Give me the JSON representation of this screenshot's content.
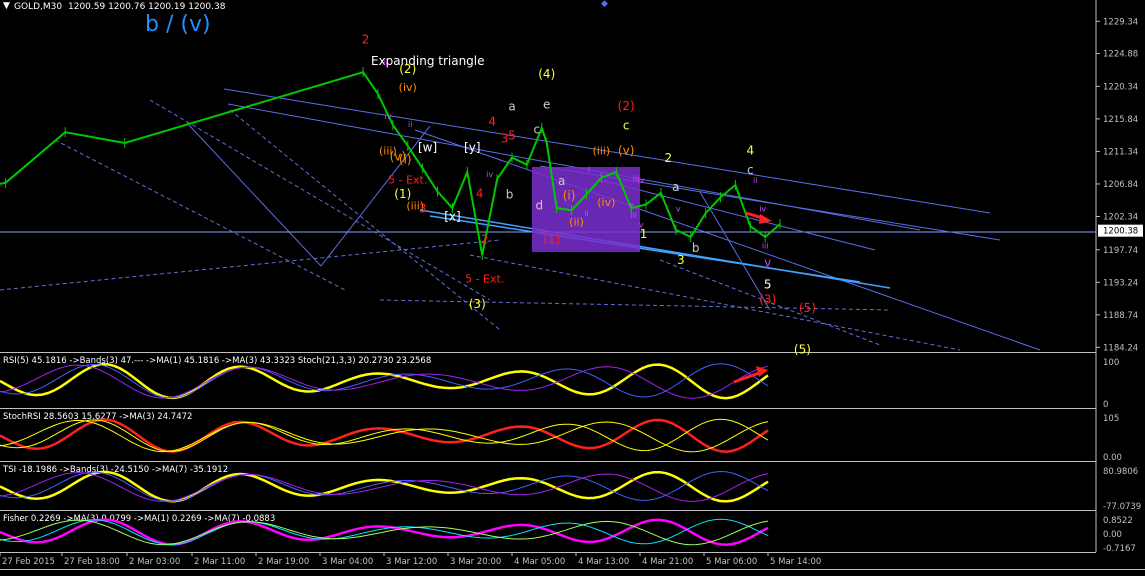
{
  "header": {
    "symbol_label": "GOLD,M30",
    "ohlc_label": "1200.59 1200.76 1200.19 1200.38"
  },
  "colors": {
    "background": "#000000",
    "axis": "#c0c0c0",
    "bull_candle": "#00c800",
    "bear_candle": "#00c800",
    "trendline": "#5a6ee8",
    "wave_red": "#ff2020",
    "wave_yellow": "#ffff40",
    "wave_orange": "#ff8c00",
    "wave_magenta": "#d040ff",
    "wave_white": "#ffffff",
    "wave_gray": "#c8c8c8",
    "highlight_box": "#7b2fd0",
    "title_blue": "#1e90ff"
  },
  "annotations": {
    "main_wave": "b / (v)",
    "pattern": "Expanding triangle",
    "labels": [
      {
        "t": "2",
        "c": "wave_red",
        "x": "2 Mar 00:30",
        "y": 1226.3
      },
      {
        "t": "(2)",
        "c": "wave_yellow",
        "x": "2 Mar 09:00",
        "y": 1222.2
      },
      {
        "t": "(4)",
        "c": "wave_yellow",
        "x": "3 Mar 13:00",
        "y": 1221.5
      },
      {
        "t": "e",
        "c": "wave_gray",
        "x": "3 Mar 13:00",
        "y": 1217.3
      },
      {
        "t": "a",
        "c": "wave_gray",
        "x": "3 Mar 06:00",
        "y": 1217.0
      },
      {
        "t": "c",
        "c": "wave_gray",
        "x": "3 Mar 11:00",
        "y": 1213.8
      },
      {
        "t": "4",
        "c": "wave_red",
        "x": "3 Mar 02:00",
        "y": 1214.9
      },
      {
        "t": "3",
        "c": "wave_red",
        "x": "3 Mar 04:30",
        "y": 1212.6
      },
      {
        "t": "5",
        "c": "wave_red",
        "x": "3 Mar 06:00",
        "y": 1213.0
      },
      {
        "t": "[w]",
        "c": "wave_white",
        "x": "2 Mar 13:00",
        "y": 1211.3
      },
      {
        "t": "[y]",
        "c": "wave_white",
        "x": "2 Mar 22:00",
        "y": 1211.3
      },
      {
        "t": "[x]",
        "c": "wave_white",
        "x": "2 Mar 18:00",
        "y": 1201.8
      },
      {
        "t": "5 - Ext.",
        "c": "wave_red",
        "x": "2 Mar 09:00",
        "y": 1206.9
      },
      {
        "t": "(1)",
        "c": "wave_yellow",
        "x": "2 Mar 08:00",
        "y": 1204.9
      },
      {
        "t": "(iii)",
        "c": "wave_orange",
        "x": "2 Mar 10:30",
        "y": 1203.3
      },
      {
        "t": "(iii)",
        "c": "wave_orange",
        "x": "2 Mar 05:00",
        "y": 1210.9
      },
      {
        "t": "(iv)",
        "c": "wave_orange",
        "x": "2 Mar 09:00",
        "y": 1219.7
      },
      {
        "t": "(v)",
        "c": "wave_orange",
        "x": "2 Mar 07:00",
        "y": 1210.1
      },
      {
        "t": "(i)",
        "c": "wave_orange",
        "x": "2 Mar 08:30",
        "y": 1209.7
      },
      {
        "t": "3",
        "c": "wave_red",
        "x": "2 Mar 12:00",
        "y": 1202.9
      },
      {
        "t": "4",
        "c": "wave_red",
        "x": "2 Mar 23:30",
        "y": 1205.0
      },
      {
        "t": "2",
        "c": "wave_red",
        "x": "3 Mar 00:30",
        "y": 1198.6
      },
      {
        "t": "b",
        "c": "wave_gray",
        "x": "3 Mar 05:30",
        "y": 1204.8
      },
      {
        "t": "5 - Ext.",
        "c": "wave_red",
        "x": "3 Mar 00:30",
        "y": 1193.2
      },
      {
        "t": "(3)",
        "c": "wave_yellow",
        "x": "2 Mar 23:00",
        "y": 1189.7
      },
      {
        "t": "d",
        "c": "wave_gray",
        "x": "3 Mar 11:30",
        "y": 1203.3
      },
      {
        "t": "a",
        "c": "wave_gray",
        "x": "3 Mar 16:00",
        "y": 1206.7
      },
      {
        "t": "(1)",
        "c": "wave_red",
        "x": "3 Mar 14:00",
        "y": 1198.6
      },
      {
        "t": "(i)",
        "c": "wave_orange",
        "x": "3 Mar 17:30",
        "y": 1204.7
      },
      {
        "t": "(ii)",
        "c": "wave_orange",
        "x": "3 Mar 19:00",
        "y": 1201.1
      },
      {
        "t": "(iii)",
        "c": "wave_orange",
        "x": "4 Mar 00:00",
        "y": 1210.9
      },
      {
        "t": "(iv)",
        "c": "wave_orange",
        "x": "4 Mar 01:00",
        "y": 1203.8
      },
      {
        "t": "(v)",
        "c": "wave_orange",
        "x": "4 Mar 05:00",
        "y": 1210.9
      },
      {
        "t": "c",
        "c": "wave_yellow",
        "x": "4 Mar 05:00",
        "y": 1214.4
      },
      {
        "t": "(2)",
        "c": "wave_red",
        "x": "4 Mar 05:00",
        "y": 1217.1
      },
      {
        "t": "1",
        "c": "wave_yellow",
        "x": "4 Mar 08:30",
        "y": 1199.4
      },
      {
        "t": "2",
        "c": "wave_yellow",
        "x": "4 Mar 13:30",
        "y": 1209.9
      },
      {
        "t": "a",
        "c": "wave_gray",
        "x": "4 Mar 15:00",
        "y": 1205.9
      },
      {
        "t": "3",
        "c": "wave_yellow",
        "x": "4 Mar 16:00",
        "y": 1195.8
      },
      {
        "t": "b",
        "c": "wave_gray",
        "x": "4 Mar 19:00",
        "y": 1197.4
      },
      {
        "t": "4",
        "c": "wave_yellow",
        "x": "5 Mar 06:00",
        "y": 1210.9
      },
      {
        "t": "c",
        "c": "wave_gray",
        "x": "5 Mar 06:00",
        "y": 1208.2
      },
      {
        "t": "v",
        "c": "wave_magenta",
        "x": "5 Mar 09:30",
        "y": 1195.4
      },
      {
        "t": "5",
        "c": "wave_white",
        "x": "5 Mar 09:30",
        "y": 1192.4
      },
      {
        "t": "(3)",
        "c": "wave_red",
        "x": "5 Mar 09:30",
        "y": 1190.3
      },
      {
        "t": "(5)",
        "c": "wave_red",
        "x": "5 Mar 17:30",
        "y": 1189.1
      },
      {
        "t": "(5)",
        "c": "wave_yellow",
        "x": "5 Mar 16:30",
        "y": 1183.4
      }
    ],
    "micro_labels": [
      {
        "t": "i",
        "x": "3 Mar 21:30",
        "y": 1208.5
      },
      {
        "t": "ii",
        "x": "3 Mar 21:00",
        "y": 1202.4
      },
      {
        "t": "iii",
        "x": "4 Mar 07:00",
        "y": 1207.2
      },
      {
        "t": "iv",
        "x": "4 Mar 08:00",
        "y": 1207.0
      },
      {
        "t": "v",
        "x": "4 Mar 06:00",
        "y": 1203.5
      },
      {
        "t": "iii",
        "x": "4 Mar 06:30",
        "y": 1202.1
      },
      {
        "t": "v",
        "x": "4 Mar 08:00",
        "y": 1200.8
      },
      {
        "t": "v",
        "x": "4 Mar 15:30",
        "y": 1203.0
      },
      {
        "t": "ii",
        "x": "5 Mar 07:00",
        "y": 1207.0
      },
      {
        "t": "iv",
        "x": "5 Mar 08:30",
        "y": 1203.0
      },
      {
        "t": "iii",
        "x": "5 Mar 09:00",
        "y": 1197.9
      },
      {
        "t": "iv",
        "x": "3 Mar 01:30",
        "y": 1207.8
      },
      {
        "t": "ii",
        "x": "2 Mar 09:30",
        "y": 1214.7
      },
      {
        "t": "iv",
        "x": "2 Mar 05:00",
        "y": 1215.8
      },
      {
        "t": "ii",
        "x": "2 Mar 04:30",
        "y": 1223.2
      }
    ]
  },
  "chart_data": {
    "type": "line",
    "series": [
      {
        "name": "GOLD,M30",
        "x": [
          "26 Feb 2015 12:00",
          "27 Feb 2015 00:00",
          "27 Feb 2015 12:00",
          "28 Feb 2015 00:00",
          "2 Mar 2015 00:00",
          "2 Mar 2015 03:00",
          "2 Mar 2015 06:00",
          "2 Mar 2015 09:00",
          "2 Mar 2015 12:00",
          "2 Mar 2015 15:00",
          "2 Mar 2015 18:00",
          "2 Mar 2015 21:00",
          "3 Mar 2015 00:00",
          "3 Mar 2015 03:00",
          "3 Mar 2015 06:00",
          "3 Mar 2015 09:00",
          "3 Mar 2015 12:00",
          "3 Mar 2015 13:00",
          "3 Mar 2015 15:00",
          "3 Mar 2015 18:00",
          "3 Mar 2015 21:00",
          "4 Mar 2015 00:00",
          "4 Mar 2015 03:00",
          "4 Mar 2015 06:00",
          "4 Mar 2015 09:00",
          "4 Mar 2015 12:00",
          "4 Mar 2015 15:00",
          "4 Mar 2015 18:00",
          "4 Mar 2015 21:00",
          "5 Mar 2015 00:00",
          "5 Mar 2015 03:00",
          "5 Mar 2015 06:00",
          "5 Mar 2015 09:00",
          "5 Mar 2015 12:00"
        ],
        "values": [
          1205.5,
          1207.0,
          1214.0,
          1212.5,
          1222.3,
          1219.3,
          1215.0,
          1212.1,
          1209.0,
          1205.8,
          1203.5,
          1208.5,
          1197.0,
          1207.5,
          1210.5,
          1209.5,
          1214.6,
          1212.5,
          1203.5,
          1203.2,
          1205.4,
          1207.7,
          1208.5,
          1203.5,
          1204.0,
          1205.6,
          1200.5,
          1199.5,
          1202.8,
          1205.0,
          1206.7,
          1201.0,
          1199.5,
          1201.3
        ]
      }
    ],
    "x_ticks": [
      "27 Feb 2015",
      "27 Feb 18:00",
      "2 Mar 03:00",
      "2 Mar 11:00",
      "2 Mar 19:00",
      "3 Mar 04:00",
      "3 Mar 12:00",
      "3 Mar 20:00",
      "4 Mar 05:00",
      "4 Mar 13:00",
      "4 Mar 21:00",
      "5 Mar 06:00",
      "5 Mar 14:00"
    ],
    "y_ticks": [
      1229.34,
      1224.88,
      1220.34,
      1215.84,
      1211.34,
      1206.84,
      1202.34,
      1197.74,
      1193.24,
      1188.74,
      1184.24
    ],
    "ylim": [
      1183.6,
      1230.9
    ],
    "last_price": 1200.38,
    "indicators": [
      {
        "name": "RSI",
        "label": "RSI(5) 45.1816   ->Bands(3) 47.---   ->MA(1) 45.1816   ->MA(3) 43.3323   Stoch(21,3,3) 20.2730 23.2568",
        "y_ticks": [
          "100",
          "0"
        ],
        "ylim": [
          0,
          100
        ]
      },
      {
        "name": "StochRSI",
        "label": "StochRSI 28.5603 15.6277   ->MA(3) 24.7472",
        "y_ticks": [
          "105",
          "0.00"
        ],
        "ylim": [
          0,
          105
        ]
      },
      {
        "name": "TSI",
        "label": "TSI -18.1986   ->Bands(3) -24.5150   ->MA(7) -35.1912",
        "y_ticks": [
          "80.9806",
          "-77.0739"
        ],
        "ylim": [
          -77.0739,
          80.9806
        ]
      },
      {
        "name": "Fisher",
        "label": "Fisher 0.2269   ->MA(3) 0.0799   ->MA(1) 0.2269   ->MA(7) -0.0883",
        "y_ticks": [
          "0.8522",
          "0.00",
          "-0.7167"
        ],
        "ylim": [
          -0.7167,
          0.8522
        ]
      }
    ],
    "grid": false,
    "legend": "top-left"
  }
}
